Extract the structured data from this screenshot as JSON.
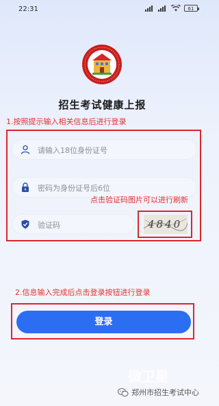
{
  "status_bar": {
    "time": "22:31",
    "battery": "61"
  },
  "title": "招生考试健康上报",
  "annotations": {
    "step1": "1.按照提示输入相关信息后进行登录",
    "captcha_hint": "点击验证码图片可以进行刷新",
    "step2": "2.信息输入完成后点击登录按钮进行登录"
  },
  "form": {
    "id_placeholder": "请输入18位身份证号",
    "password_placeholder": "密码为身份证号后6位",
    "captcha_placeholder": "验证码",
    "captcha_text": "4840"
  },
  "login_button": "登录",
  "watermark": {
    "ghost": "微卫星",
    "account": "郑州市招生考试中心"
  },
  "colors": {
    "primary": "#2b6ef2",
    "annotation": "#e5312e",
    "logo_red": "#c81e1e"
  },
  "icons": [
    "user-icon",
    "lock-icon",
    "shield-check-icon",
    "wechat-icon"
  ]
}
